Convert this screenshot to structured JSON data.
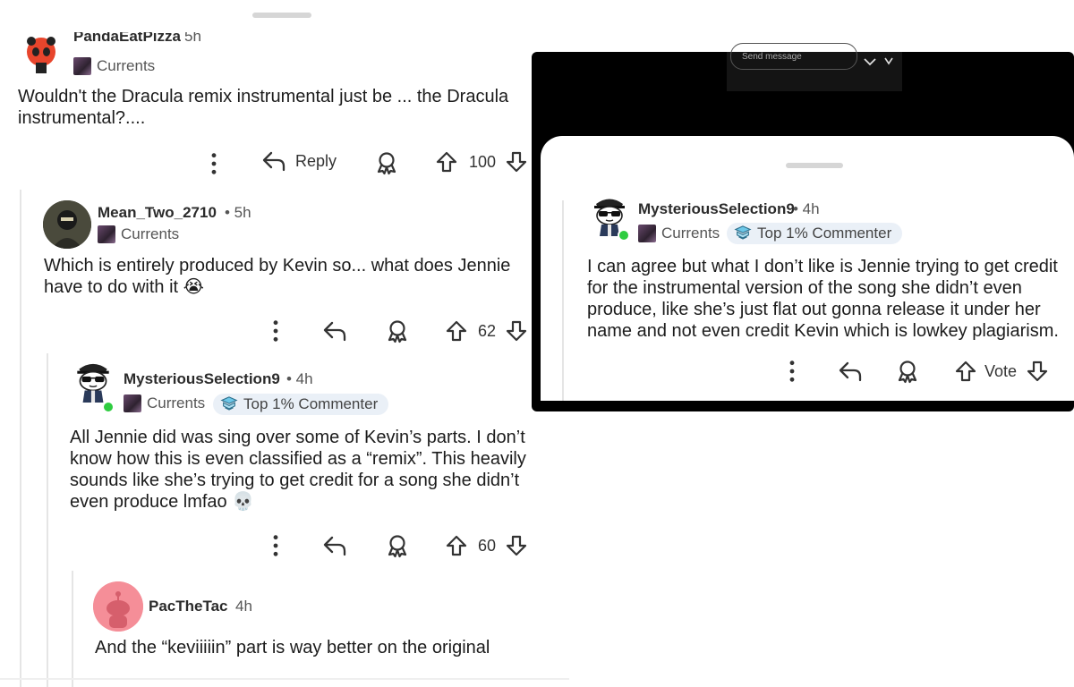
{
  "left": {
    "comments": [
      {
        "username": "PandaEatPizza",
        "time": "5h",
        "flair": "Currents",
        "body": "Wouldn't the Dracula remix instrumental just be ... the Dracula instrumental?....",
        "reply_label": "Reply",
        "votes": "100"
      },
      {
        "username": "Mean_Two_2710",
        "time": "• 5h",
        "flair": "Currents",
        "body": "Which is entirely produced by Kevin so... what does Jennie have to do with it 😭",
        "votes": "62"
      },
      {
        "username": "MysteriousSelection9",
        "time": "• 4h",
        "flair": "Currents",
        "badge": "Top 1% Commenter",
        "body": "All Jennie did was sing over some of Kevin’s parts. I don’t know how this is even classified as a “remix”. This heavily sounds like she’s trying to get credit for a song she didn’t even produce lmfao 💀",
        "votes": "60"
      },
      {
        "username": "PacTheTac",
        "time": "4h",
        "body": "And the “keviiiiin” part is way better on the original"
      }
    ]
  },
  "right": {
    "send_message_placeholder": "Send message",
    "comment": {
      "username": "MysteriousSelection9",
      "time": "• 4h",
      "flair": "Currents",
      "badge": "Top 1% Commenter",
      "body": "I can agree but what I don’t like is Jennie trying to get credit for the instrumental version of the song she didn’t even produce, like she’s just flat out gonna release it under her name and not even credit Kevin which is lowkey plagiarism.",
      "vote_label": "Vote"
    }
  },
  "icons": [
    "more-icon",
    "reply-icon",
    "award-icon",
    "upvote-icon",
    "downvote-icon",
    "chevron-down-icon"
  ],
  "colors": {
    "online": "#2ecc40",
    "badge_bg": "#eaf0f7",
    "dark_panel": "#000000"
  }
}
